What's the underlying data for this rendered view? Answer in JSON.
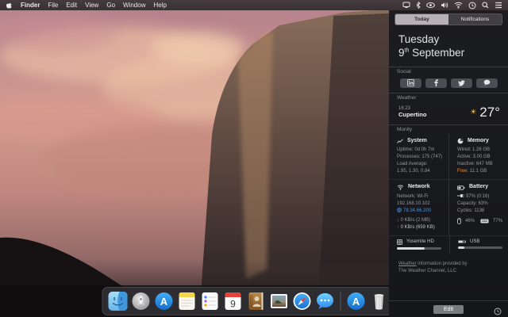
{
  "colors": {
    "accent_blue": "#4a90d9",
    "free_orange": "#e0913d",
    "sun_yellow": "#f6c64e",
    "selected_tab_bg": "#b7b0b4",
    "panel_bg": "#1b1c20",
    "menubar_bg": "#3a3134"
  },
  "menu_bar": {
    "apple_icon": "apple-logo",
    "items": [
      "Finder",
      "File",
      "Edit",
      "View",
      "Go",
      "Window",
      "Help"
    ],
    "status_icons": [
      "display",
      "bluetooth",
      "eye",
      "volume",
      "wifi",
      "clock",
      "spotlight",
      "notification-center"
    ]
  },
  "notification_center": {
    "tabs": [
      {
        "label": "Today",
        "selected": true
      },
      {
        "label": "Notifications",
        "selected": false
      }
    ],
    "date": {
      "weekday": "Tuesday",
      "day": "9",
      "suffix": "th",
      "month": "September"
    },
    "social": {
      "label": "Social",
      "buttons": [
        "linkedin",
        "facebook",
        "twitter",
        "messages"
      ]
    },
    "weather": {
      "label": "Weather",
      "time": "16:23",
      "city": "Cupertino",
      "temperature": "27°",
      "condition_icon": "sun"
    },
    "monity": {
      "label": "Monity",
      "system": {
        "title": "System",
        "lines": [
          "Uptime: 0d 0h 7m",
          "Processes: 175 (747)",
          "Load Average:",
          "1.95, 1.30, 0.84"
        ]
      },
      "memory": {
        "title": "Memory",
        "lines": [
          "Wired: 1.26 GB",
          "Active: 3.00 GB",
          "Inactive: 647 MB"
        ],
        "free_label": "Free:",
        "free_value": "11.1 GB"
      },
      "network": {
        "title": "Network",
        "type": "Network: Wi-Fi",
        "local_ip": "192.168.10.102",
        "public_ip": "78.34.66.200",
        "down": "0 KB/s (2 MB)",
        "up": "0 KB/s (659 KB)",
        "down_arrow": "↓",
        "up_arrow": "↑"
      },
      "battery": {
        "title": "Battery",
        "charge": "97% (0:16)",
        "capacity": "Capacity: 63%",
        "cycles": "Cycles: 1138",
        "mouse_level": "46%",
        "keyboard_level": "77%"
      },
      "disks": [
        {
          "name": "Yosemite HD",
          "used_percent": 63
        },
        {
          "name": "USB",
          "used_percent": 15
        }
      ]
    },
    "attribution": {
      "link_text": "Weather",
      "line1_rest": " information provided by",
      "line2": "The Weather Channel, LLC"
    },
    "edit_button": "Edit"
  },
  "dock": {
    "calendar_day": "9",
    "items": [
      "finder",
      "launchpad",
      "app-store",
      "notes",
      "reminders",
      "calendar",
      "contacts",
      "preview",
      "safari",
      "messages",
      "applications",
      "trash"
    ]
  }
}
